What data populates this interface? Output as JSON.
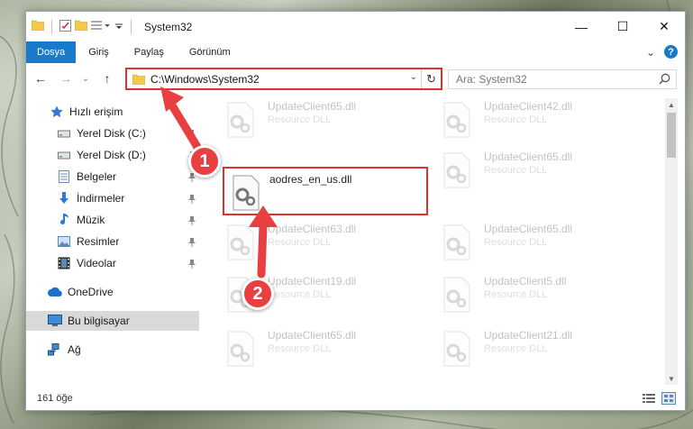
{
  "window": {
    "title": "System32",
    "controls": {
      "minimize": "—",
      "maximize": "☐",
      "close": "✕"
    }
  },
  "ribbon": {
    "tabs": [
      "Dosya",
      "Giriş",
      "Paylaş",
      "Görünüm"
    ],
    "active_tab": "Dosya",
    "expand_glyph": "⌄",
    "help_glyph": "?"
  },
  "address": {
    "path": "C:\\Windows\\System32",
    "dropdown_glyph": "⌄",
    "refresh_glyph": "↻",
    "back_glyph": "←",
    "forward_glyph": "→",
    "recent_glyph": "⌄",
    "up_glyph": "↑"
  },
  "search": {
    "placeholder": "Ara: System32"
  },
  "nav": {
    "items": [
      {
        "label": "Hızlı erişim",
        "icon": "star-icon",
        "pinned": false
      },
      {
        "label": "Yerel Disk (C:)",
        "icon": "drive-icon",
        "pinned": true
      },
      {
        "label": "Yerel Disk (D:)",
        "icon": "drive-icon",
        "pinned": true
      },
      {
        "label": "Belgeler",
        "icon": "documents-icon",
        "pinned": true
      },
      {
        "label": "İndirmeler",
        "icon": "download-icon",
        "pinned": true
      },
      {
        "label": "Müzik",
        "icon": "music-icon",
        "pinned": true
      },
      {
        "label": "Resimler",
        "icon": "pictures-icon",
        "pinned": true
      },
      {
        "label": "Videolar",
        "icon": "video-icon",
        "pinned": true
      },
      {
        "label": "OneDrive",
        "icon": "cloud-icon",
        "pinned": false
      },
      {
        "label": "Bu bilgisayar",
        "icon": "computer-icon",
        "pinned": false
      },
      {
        "label": "Ağ",
        "icon": "network-icon",
        "pinned": false
      }
    ],
    "selected": "Bu bilgisayar"
  },
  "files": [
    {
      "name": "UpdateClient65.dll",
      "type": "Resource DLL",
      "faded": true
    },
    {
      "name": "UpdateClient42.dll",
      "type": "Resource DLL",
      "faded": true
    },
    {
      "name": "aodres_en_us.dll",
      "type": "",
      "faded": false,
      "highlighted": true
    },
    {
      "name": "UpdateClient65.dll",
      "type": "Resource DLL",
      "faded": true
    },
    {
      "name": "UpdateClient63.dll",
      "type": "Resource DLL",
      "faded": true
    },
    {
      "name": "UpdateClient65.dll",
      "type": "Resource DLL",
      "faded": true
    },
    {
      "name": "UpdateClient19.dll",
      "type": "Resource DLL",
      "faded": true
    },
    {
      "name": "UpdateClient5.dll",
      "type": "Resource DLL",
      "faded": true
    },
    {
      "name": "UpdateClient65.dll",
      "type": "Resource DLL",
      "faded": true
    },
    {
      "name": "UpdateClient21.dll",
      "type": "Resource DLL",
      "faded": true
    }
  ],
  "status": {
    "item_count": "161 öğe"
  },
  "annotations": {
    "step1": "1",
    "step2": "2"
  },
  "colors": {
    "accent": "#1979ca",
    "annotation_red": "#e03030"
  }
}
